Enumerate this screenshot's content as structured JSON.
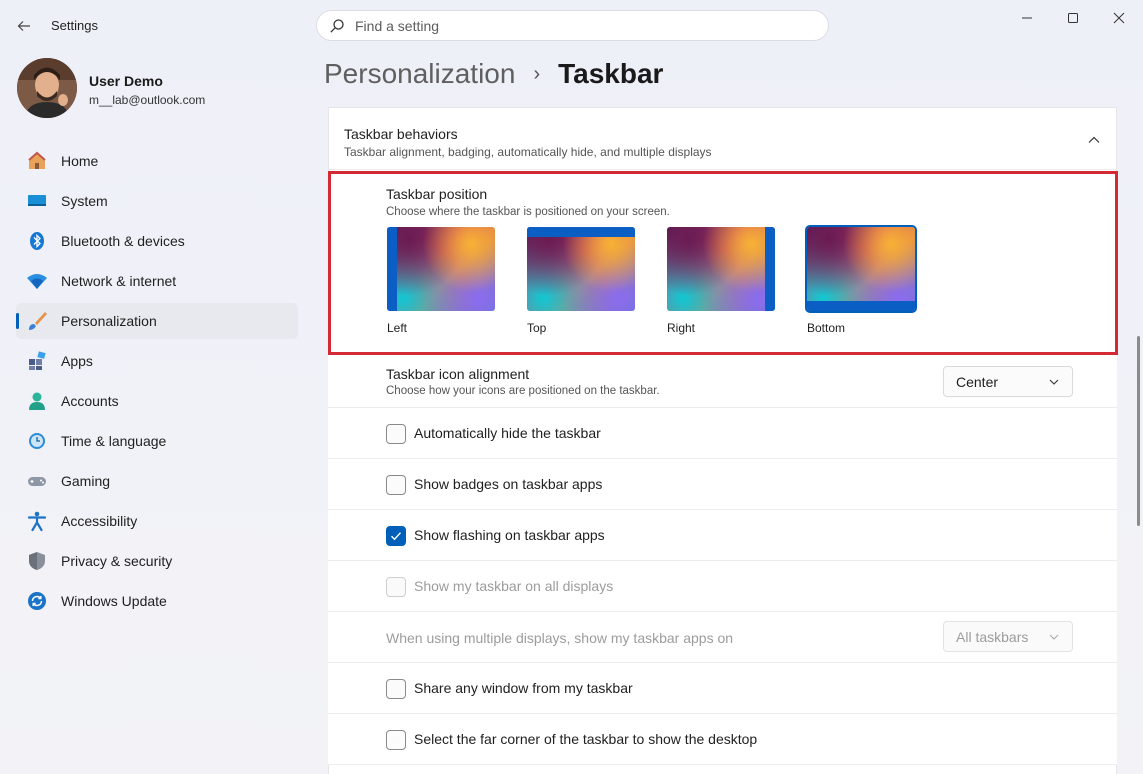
{
  "window": {
    "title": "Settings",
    "minimize_label": "Minimize",
    "maximize_label": "Maximize",
    "close_label": "Close"
  },
  "search": {
    "placeholder": "Find a setting"
  },
  "profile": {
    "name": "User Demo",
    "email": "m__lab@outlook.com"
  },
  "nav": {
    "items": [
      {
        "label": "Home",
        "icon": "home-icon"
      },
      {
        "label": "System",
        "icon": "system-icon"
      },
      {
        "label": "Bluetooth & devices",
        "icon": "bluetooth-icon"
      },
      {
        "label": "Network & internet",
        "icon": "wifi-icon"
      },
      {
        "label": "Personalization",
        "icon": "brush-icon",
        "active": true
      },
      {
        "label": "Apps",
        "icon": "apps-icon"
      },
      {
        "label": "Accounts",
        "icon": "accounts-icon"
      },
      {
        "label": "Time & language",
        "icon": "clock-icon"
      },
      {
        "label": "Gaming",
        "icon": "gamepad-icon"
      },
      {
        "label": "Accessibility",
        "icon": "accessibility-icon"
      },
      {
        "label": "Privacy & security",
        "icon": "shield-icon"
      },
      {
        "label": "Windows Update",
        "icon": "update-icon"
      }
    ]
  },
  "breadcrumb": {
    "parent": "Personalization",
    "separator": "›",
    "current": "Taskbar"
  },
  "behaviors": {
    "title": "Taskbar behaviors",
    "subtitle": "Taskbar alignment, badging, automatically hide, and multiple displays",
    "position": {
      "title": "Taskbar position",
      "subtitle": "Choose where the taskbar is positioned on your screen.",
      "options": [
        {
          "label": "Left",
          "selected": false
        },
        {
          "label": "Top",
          "selected": false
        },
        {
          "label": "Right",
          "selected": false
        },
        {
          "label": "Bottom",
          "selected": true
        }
      ]
    },
    "alignment": {
      "title": "Taskbar icon alignment",
      "subtitle": "Choose how your icons are positioned on the taskbar.",
      "value": "Center"
    },
    "checkboxes": [
      {
        "label": "Automatically hide the taskbar",
        "checked": false,
        "disabled": false
      },
      {
        "label": "Show badges on taskbar apps",
        "checked": false,
        "disabled": false
      },
      {
        "label": "Show flashing on taskbar apps",
        "checked": true,
        "disabled": false
      },
      {
        "label": "Show my taskbar on all displays",
        "checked": false,
        "disabled": true
      }
    ],
    "multi_display": {
      "label": "When using multiple displays, show my taskbar apps on",
      "value": "All taskbars",
      "disabled": true
    },
    "checkboxes2": [
      {
        "label": "Share any window from my taskbar",
        "checked": false
      },
      {
        "label": "Select the far corner of the taskbar to show the desktop",
        "checked": false
      }
    ]
  },
  "colors": {
    "accent": "#005fb8",
    "highlight_border": "#d32a35"
  }
}
